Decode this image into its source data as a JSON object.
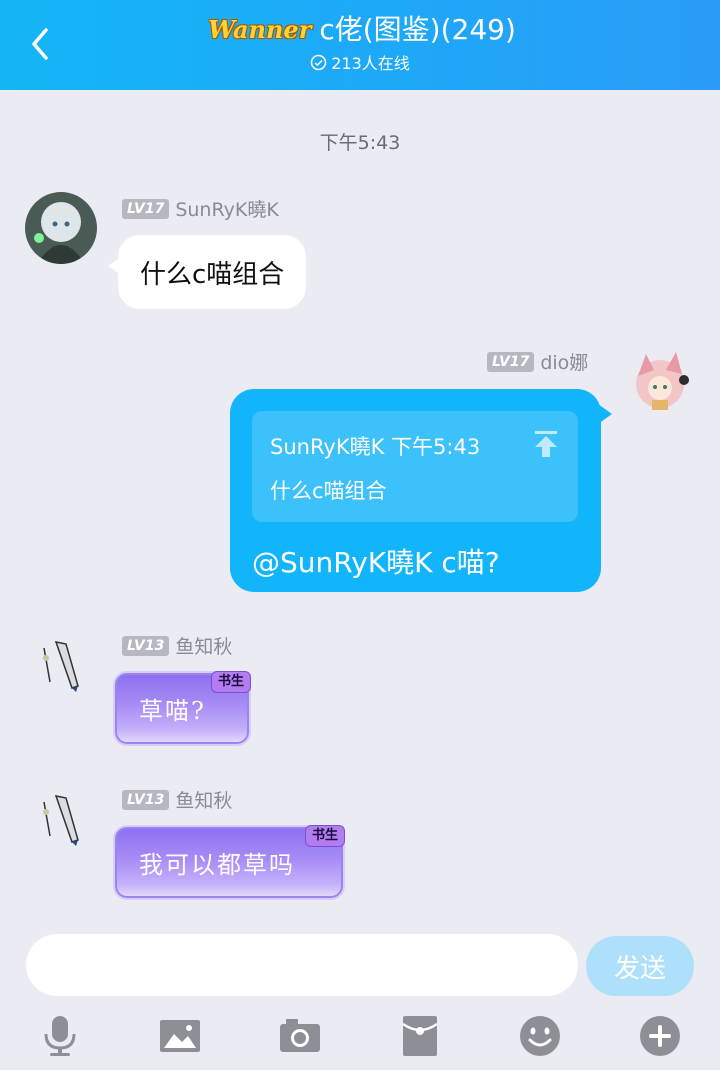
{
  "header": {
    "logo_text": "Wanner",
    "title": "c佬(图鉴)(249)",
    "online": "213人在线"
  },
  "timestamp": "下午5:43",
  "messages": [
    {
      "level": "LV17",
      "name": "SunRyK曉K",
      "text": "什么c喵组合"
    },
    {
      "level": "LV17",
      "name": "dio娜",
      "quote_head": "SunRyK曉K 下午5:43",
      "quote_text": "什么c喵组合",
      "text": "@SunRyK曉K c喵?"
    },
    {
      "level": "LV13",
      "name": "鱼知秋",
      "title": "书生",
      "text": "草喵?"
    },
    {
      "level": "LV13",
      "name": "鱼知秋",
      "title": "书生",
      "text": "我可以都草吗"
    }
  ],
  "composer": {
    "value": "",
    "send_label": "发送"
  },
  "icons": [
    "back-icon",
    "online-check-icon",
    "jump-to-quote-icon",
    "microphone-icon",
    "image-icon",
    "camera-icon",
    "red-packet-icon",
    "emoji-icon",
    "plus-icon"
  ],
  "colors": {
    "header": "#14b6f6",
    "self_bubble": "#12b4fb",
    "send_button": "#aee0fb",
    "background": "#ebebf3"
  }
}
